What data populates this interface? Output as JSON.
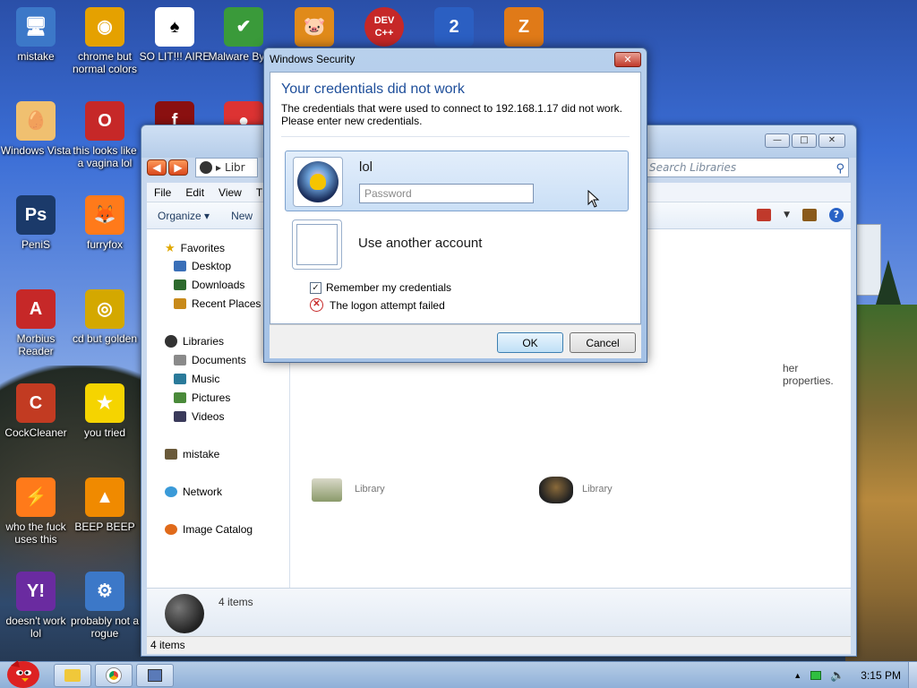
{
  "desktop": {
    "icons": [
      {
        "label": "mistake",
        "color": "#3c78c8",
        "glyph": "🖥"
      },
      {
        "label": "chrome but normal colors",
        "color": "#e5a100",
        "glyph": "◉"
      },
      {
        "label": "SO LIT!!! AIRE",
        "color": "#ffffff",
        "glyph": "♠"
      },
      {
        "label": "Malware Bytes",
        "color": "#3a9a3a",
        "glyph": "✔"
      },
      {
        "label": "",
        "color": "#e08a1a",
        "glyph": "🐷"
      },
      {
        "label": "",
        "color": "#c62828",
        "glyph": "DEV C++"
      },
      {
        "label": "",
        "color": "#2b5fc2",
        "glyph": "2"
      },
      {
        "label": "",
        "color": "#e07a18",
        "glyph": "Z"
      },
      {
        "label": "Windows Vista",
        "color": "#f0c070",
        "glyph": "🥚"
      },
      {
        "label": "this looks like a vagina lol",
        "color": "#c62828",
        "glyph": "O"
      },
      {
        "label": "",
        "color": "#8a1010",
        "glyph": "f"
      },
      {
        "label": "",
        "color": "#d33",
        "glyph": "●"
      },
      {
        "label": "PeniS",
        "color": "#1b3a6a",
        "glyph": "Ps"
      },
      {
        "label": "furryfox",
        "color": "#ff7a1a",
        "glyph": "🦊"
      },
      {
        "label": "Morbius Reader",
        "color": "#c62828",
        "glyph": "A"
      },
      {
        "label": "cd but golden",
        "color": "#d4a800",
        "glyph": "◎"
      },
      {
        "label": "CockCleaner",
        "color": "#c23b22",
        "glyph": "C"
      },
      {
        "label": "you tried",
        "color": "#f5d400",
        "glyph": "★"
      },
      {
        "label": "who the fuck uses this",
        "color": "#ff7a1a",
        "glyph": "⚡"
      },
      {
        "label": "BEEP BEEP",
        "color": "#f08a00",
        "glyph": "▲"
      },
      {
        "label": "doesn't work lol",
        "color": "#6a2ba0",
        "glyph": "Y!"
      },
      {
        "label": "probably not a rogue",
        "color": "#3c78c8",
        "glyph": "⚙"
      }
    ]
  },
  "explorer": {
    "address_text": "Libr",
    "search_placeholder": "Search Libraries",
    "menu": [
      "File",
      "Edit",
      "View",
      "T"
    ],
    "commands": {
      "organize": "Organize ▾",
      "new": "New"
    },
    "nav": {
      "favorites": "Favorites",
      "desktop": "Desktop",
      "downloads": "Downloads",
      "recent": "Recent Places",
      "libraries": "Libraries",
      "documents": "Documents",
      "music": "Music",
      "pictures": "Pictures",
      "videos": "Videos",
      "mistake": "mistake",
      "network": "Network",
      "image_catalog": "Image Catalog"
    },
    "content": {
      "props_text": "her properties.",
      "library_label": "Library"
    },
    "details_count": "4 items",
    "status": "4 items"
  },
  "dialog": {
    "title": "Windows Security",
    "close_glyph": "✕",
    "heading": "Your credentials did not work",
    "message": "The credentials that were used to connect to 192.168.1.17 did not work. Please enter new credentials.",
    "username": "lol",
    "password_placeholder": "Password",
    "other_account": "Use another account",
    "remember_label": "Remember my credentials",
    "remember_checked": true,
    "error_text": "The logon attempt failed",
    "ok_label": "OK",
    "cancel_label": "Cancel"
  },
  "taskbar": {
    "time": "3:15 PM"
  },
  "colors": {
    "accent": "#1e4e9a",
    "error": "#c62828"
  }
}
